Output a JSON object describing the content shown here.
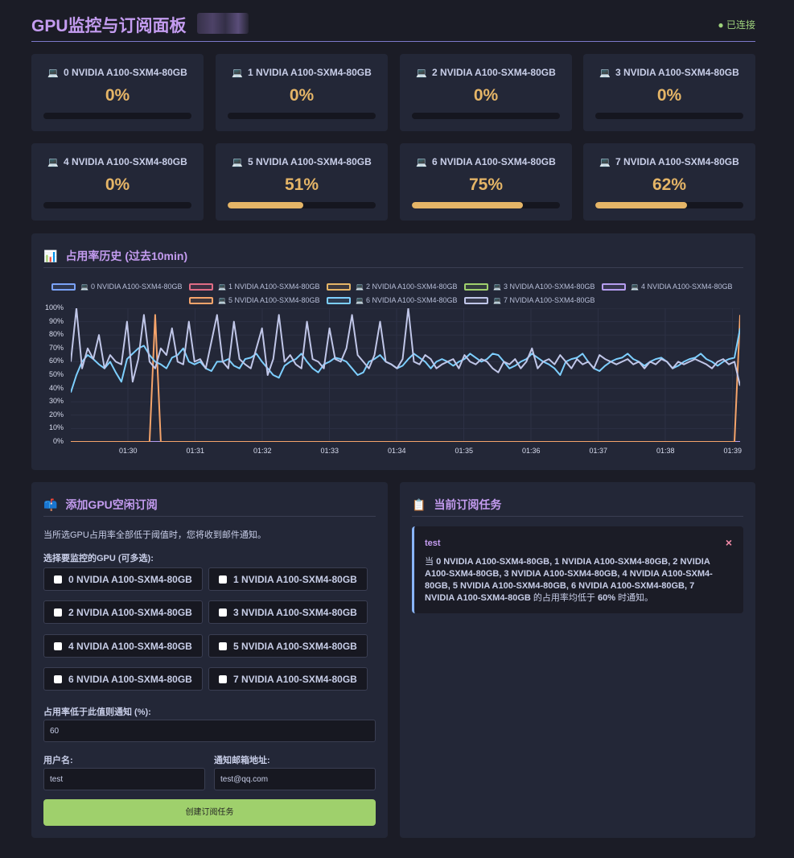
{
  "header": {
    "title": "GPU监控与订阅面板",
    "status": "● 已连接"
  },
  "gpus": [
    {
      "name": "0 NVIDIA A100-SXM4-80GB",
      "pct_label": "0%",
      "usage": 0
    },
    {
      "name": "1 NVIDIA A100-SXM4-80GB",
      "pct_label": "0%",
      "usage": 0
    },
    {
      "name": "2 NVIDIA A100-SXM4-80GB",
      "pct_label": "0%",
      "usage": 0
    },
    {
      "name": "3 NVIDIA A100-SXM4-80GB",
      "pct_label": "0%",
      "usage": 0
    },
    {
      "name": "4 NVIDIA A100-SXM4-80GB",
      "pct_label": "0%",
      "usage": 0
    },
    {
      "name": "5 NVIDIA A100-SXM4-80GB",
      "pct_label": "51%",
      "usage": 51
    },
    {
      "name": "6 NVIDIA A100-SXM4-80GB",
      "pct_label": "75%",
      "usage": 75
    },
    {
      "name": "7 NVIDIA A100-SXM4-80GB",
      "pct_label": "62%",
      "usage": 62
    }
  ],
  "history": {
    "title": "占用率历史 (过去10min)",
    "icon": "bar-chart-icon"
  },
  "chart_data": {
    "type": "line",
    "ylim": [
      0,
      100
    ],
    "y_ticks": [
      "100%",
      "90%",
      "80%",
      "70%",
      "60%",
      "50%",
      "40%",
      "30%",
      "20%",
      "10%",
      "0%"
    ],
    "x_ticks": [
      "01:30",
      "01:31",
      "01:32",
      "01:33",
      "01:34",
      "01:35",
      "01:36",
      "01:37",
      "01:38",
      "01:39"
    ],
    "grid": true,
    "legend_position": "top",
    "series": [
      {
        "name": "0 NVIDIA A100-SXM4-80GB",
        "color": "#7aa2f7",
        "values": [
          0,
          0,
          0,
          0,
          0,
          0,
          0,
          0,
          0,
          0,
          0,
          0,
          0,
          0,
          0,
          0,
          0,
          0,
          0,
          0,
          0,
          0,
          0,
          0,
          0,
          0,
          0,
          0,
          0,
          0,
          0,
          0,
          0,
          0,
          0,
          0,
          0,
          0,
          0,
          0,
          0,
          0,
          0,
          0,
          0,
          0,
          0,
          0,
          0,
          0,
          0,
          0,
          0,
          0,
          0,
          0,
          0,
          0,
          0,
          0,
          0,
          0,
          0,
          0,
          0,
          0,
          0,
          0,
          0,
          0,
          0,
          0,
          0,
          0,
          0,
          0,
          0,
          0,
          0,
          0,
          0,
          0,
          0,
          0,
          0,
          0,
          0,
          0,
          0,
          0,
          0,
          0,
          0,
          0,
          0,
          0,
          0,
          0,
          0,
          0,
          0,
          0,
          0,
          0,
          0,
          0,
          0,
          0,
          0,
          0,
          0,
          0,
          0,
          0,
          0,
          0,
          0,
          0,
          0,
          0
        ]
      },
      {
        "name": "1 NVIDIA A100-SXM4-80GB",
        "color": "#e06c85",
        "values": [
          0,
          0,
          0,
          0,
          0,
          0,
          0,
          0,
          0,
          0,
          0,
          0,
          0,
          0,
          0,
          0,
          0,
          0,
          0,
          0,
          0,
          0,
          0,
          0,
          0,
          0,
          0,
          0,
          0,
          0,
          0,
          0,
          0,
          0,
          0,
          0,
          0,
          0,
          0,
          0,
          0,
          0,
          0,
          0,
          0,
          0,
          0,
          0,
          0,
          0,
          0,
          0,
          0,
          0,
          0,
          0,
          0,
          0,
          0,
          0,
          0,
          0,
          0,
          0,
          0,
          0,
          0,
          0,
          0,
          0,
          0,
          0,
          0,
          0,
          0,
          0,
          0,
          0,
          0,
          0,
          0,
          0,
          0,
          0,
          0,
          0,
          0,
          0,
          0,
          0,
          0,
          0,
          0,
          0,
          0,
          0,
          0,
          0,
          0,
          0,
          0,
          0,
          0,
          0,
          0,
          0,
          0,
          0,
          0,
          0,
          0,
          0,
          0,
          0,
          0,
          0,
          0,
          0,
          0,
          0
        ]
      },
      {
        "name": "2 NVIDIA A100-SXM4-80GB",
        "color": "#e5b567",
        "values": [
          0,
          0,
          0,
          0,
          0,
          0,
          0,
          0,
          0,
          0,
          0,
          0,
          0,
          0,
          0,
          0,
          0,
          0,
          0,
          0,
          0,
          0,
          0,
          0,
          0,
          0,
          0,
          0,
          0,
          0,
          0,
          0,
          0,
          0,
          0,
          0,
          0,
          0,
          0,
          0,
          0,
          0,
          0,
          0,
          0,
          0,
          0,
          0,
          0,
          0,
          0,
          0,
          0,
          0,
          0,
          0,
          0,
          0,
          0,
          0,
          0,
          0,
          0,
          0,
          0,
          0,
          0,
          0,
          0,
          0,
          0,
          0,
          0,
          0,
          0,
          0,
          0,
          0,
          0,
          0,
          0,
          0,
          0,
          0,
          0,
          0,
          0,
          0,
          0,
          0,
          0,
          0,
          0,
          0,
          0,
          0,
          0,
          0,
          0,
          0,
          0,
          0,
          0,
          0,
          0,
          0,
          0,
          0,
          0,
          0,
          0,
          0,
          0,
          0,
          0,
          0,
          0,
          0,
          0,
          0
        ]
      },
      {
        "name": "3 NVIDIA A100-SXM4-80GB",
        "color": "#9fd06c",
        "values": [
          0,
          0,
          0,
          0,
          0,
          0,
          0,
          0,
          0,
          0,
          0,
          0,
          0,
          0,
          0,
          0,
          0,
          0,
          0,
          0,
          0,
          0,
          0,
          0,
          0,
          0,
          0,
          0,
          0,
          0,
          0,
          0,
          0,
          0,
          0,
          0,
          0,
          0,
          0,
          0,
          0,
          0,
          0,
          0,
          0,
          0,
          0,
          0,
          0,
          0,
          0,
          0,
          0,
          0,
          0,
          0,
          0,
          0,
          0,
          0,
          0,
          0,
          0,
          0,
          0,
          0,
          0,
          0,
          0,
          0,
          0,
          0,
          0,
          0,
          0,
          0,
          0,
          0,
          0,
          0,
          0,
          0,
          0,
          0,
          0,
          0,
          0,
          0,
          0,
          0,
          0,
          0,
          0,
          0,
          0,
          0,
          0,
          0,
          0,
          0,
          0,
          0,
          0,
          0,
          0,
          0,
          0,
          0,
          0,
          0,
          0,
          0,
          0,
          0,
          0,
          0,
          0,
          0,
          0,
          0
        ]
      },
      {
        "name": "4 NVIDIA A100-SXM4-80GB",
        "color": "#b59df0",
        "values": [
          0,
          0,
          0,
          0,
          0,
          0,
          0,
          0,
          0,
          0,
          0,
          0,
          0,
          0,
          0,
          0,
          0,
          0,
          0,
          0,
          0,
          0,
          0,
          0,
          0,
          0,
          0,
          0,
          0,
          0,
          0,
          0,
          0,
          0,
          0,
          0,
          0,
          0,
          0,
          0,
          0,
          0,
          0,
          0,
          0,
          0,
          0,
          0,
          0,
          0,
          0,
          0,
          0,
          0,
          0,
          0,
          0,
          0,
          0,
          0,
          0,
          0,
          0,
          0,
          0,
          0,
          0,
          0,
          0,
          0,
          0,
          0,
          0,
          0,
          0,
          0,
          0,
          0,
          0,
          0,
          0,
          0,
          0,
          0,
          0,
          0,
          0,
          0,
          0,
          0,
          0,
          0,
          0,
          0,
          0,
          0,
          0,
          0,
          0,
          0,
          0,
          0,
          0,
          0,
          0,
          0,
          0,
          0,
          0,
          0,
          0,
          0,
          0,
          0,
          0,
          0,
          0,
          0,
          0,
          0
        ]
      },
      {
        "name": "5 NVIDIA A100-SXM4-80GB",
        "color": "#f5a46b",
        "values": [
          0,
          0,
          0,
          0,
          0,
          0,
          0,
          0,
          0,
          0,
          0,
          0,
          0,
          0,
          0,
          95,
          0,
          0,
          0,
          0,
          0,
          0,
          0,
          0,
          0,
          0,
          0,
          0,
          0,
          0,
          0,
          0,
          0,
          0,
          0,
          0,
          0,
          0,
          0,
          0,
          0,
          0,
          0,
          0,
          0,
          0,
          0,
          0,
          0,
          0,
          0,
          0,
          0,
          0,
          0,
          0,
          0,
          0,
          0,
          0,
          0,
          0,
          0,
          0,
          0,
          0,
          0,
          0,
          0,
          0,
          0,
          0,
          0,
          0,
          0,
          0,
          0,
          0,
          0,
          0,
          0,
          0,
          0,
          0,
          0,
          0,
          0,
          0,
          0,
          0,
          0,
          0,
          0,
          0,
          0,
          0,
          0,
          0,
          0,
          0,
          0,
          0,
          0,
          0,
          0,
          0,
          0,
          0,
          0,
          0,
          0,
          0,
          0,
          0,
          0,
          0,
          0,
          0,
          0,
          95
        ]
      },
      {
        "name": "6 NVIDIA A100-SXM4-80GB",
        "color": "#7dcfff",
        "values": [
          37,
          50,
          60,
          65,
          62,
          58,
          55,
          60,
          52,
          45,
          62,
          66,
          70,
          72,
          65,
          60,
          58,
          55,
          63,
          65,
          70,
          60,
          58,
          60,
          55,
          53,
          60,
          60,
          62,
          57,
          55,
          62,
          63,
          66,
          60,
          55,
          50,
          48,
          57,
          60,
          62,
          66,
          60,
          55,
          52,
          58,
          60,
          63,
          62,
          60,
          55,
          50,
          52,
          60,
          62,
          65,
          60,
          58,
          55,
          57,
          62,
          66,
          63,
          60,
          55,
          60,
          62,
          60,
          57,
          60,
          62,
          66,
          63,
          60,
          62,
          66,
          65,
          60,
          55,
          57,
          60,
          62,
          66,
          63,
          60,
          58,
          55,
          50,
          60,
          62,
          63,
          66,
          60,
          55,
          53,
          57,
          60,
          62,
          63,
          66,
          62,
          60,
          57,
          60,
          62,
          63,
          60,
          55,
          57,
          60,
          62,
          63,
          66,
          62,
          60,
          57,
          60,
          62,
          63,
          85
        ]
      },
      {
        "name": "7 NVIDIA A100-SXM4-80GB",
        "color": "#c0c6e8",
        "values": [
          60,
          100,
          55,
          70,
          62,
          80,
          55,
          65,
          60,
          58,
          90,
          45,
          62,
          95,
          60,
          55,
          70,
          65,
          85,
          60,
          58,
          90,
          60,
          62,
          55,
          75,
          95,
          60,
          55,
          90,
          62,
          58,
          55,
          70,
          85,
          50,
          62,
          95,
          60,
          65,
          58,
          55,
          90,
          62,
          60,
          55,
          85,
          62,
          60,
          70,
          95,
          65,
          60,
          55,
          65,
          90,
          60,
          58,
          55,
          62,
          100,
          60,
          58,
          65,
          62,
          55,
          58,
          60,
          62,
          55,
          65,
          60,
          58,
          62,
          60,
          55,
          52,
          60,
          58,
          62,
          55,
          60,
          70,
          55,
          60,
          62,
          58,
          65,
          60,
          55,
          62,
          58,
          60,
          55,
          65,
          62,
          60,
          58,
          60,
          62,
          58,
          60,
          55,
          60,
          58,
          62,
          60,
          55,
          60,
          58,
          60,
          62,
          60,
          58,
          55,
          60,
          62,
          58,
          60,
          42
        ]
      }
    ]
  },
  "subscribe": {
    "title": "添加GPU空闲订阅",
    "icon": "mailbox-icon",
    "desc": "当所选GPU占用率全部低于阈值时，您将收到邮件通知。",
    "select_label": "选择要监控的GPU (可多选):",
    "options": [
      "0 NVIDIA A100-SXM4-80GB",
      "1 NVIDIA A100-SXM4-80GB",
      "2 NVIDIA A100-SXM4-80GB",
      "3 NVIDIA A100-SXM4-80GB",
      "4 NVIDIA A100-SXM4-80GB",
      "5 NVIDIA A100-SXM4-80GB",
      "6 NVIDIA A100-SXM4-80GB",
      "7 NVIDIA A100-SXM4-80GB"
    ],
    "threshold_label": "占用率低于此值则通知 (%):",
    "threshold_value": "60",
    "username_label": "用户名:",
    "username_value": "test",
    "email_label": "通知邮箱地址:",
    "email_value": "test@qq.com",
    "submit_label": "创建订阅任务"
  },
  "tasks": {
    "title": "当前订阅任务",
    "icon": "clipboard-icon",
    "items": [
      {
        "name": "test",
        "desc_prefix": "当 ",
        "gpus": "0 NVIDIA A100-SXM4-80GB, 1 NVIDIA A100-SXM4-80GB, 2 NVIDIA A100-SXM4-80GB, 3 NVIDIA A100-SXM4-80GB, 4 NVIDIA A100-SXM4-80GB, 5 NVIDIA A100-SXM4-80GB, 6 NVIDIA A100-SXM4-80GB, 7 NVIDIA A100-SXM4-80GB",
        "desc_mid": " 的占用率均低于 ",
        "threshold": "60%",
        "desc_suffix": " 时通知。",
        "close": "×"
      }
    ]
  }
}
